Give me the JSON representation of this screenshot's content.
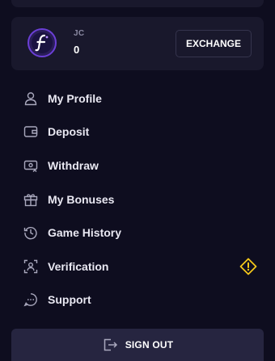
{
  "wallet": {
    "currency_code": "JC",
    "balance": "0",
    "exchange_label": "EXCHANGE"
  },
  "menu": {
    "items": [
      {
        "label": "My Profile",
        "icon": "user-icon"
      },
      {
        "label": "Deposit",
        "icon": "wallet-icon"
      },
      {
        "label": "Withdraw",
        "icon": "withdraw-icon"
      },
      {
        "label": "My Bonuses",
        "icon": "gift-icon"
      },
      {
        "label": "Game History",
        "icon": "history-icon"
      },
      {
        "label": "Verification",
        "icon": "verification-icon",
        "status_icon": "warning-icon"
      },
      {
        "label": "Support",
        "icon": "chat-icon"
      }
    ]
  },
  "sign_out": {
    "label": "SIGN OUT",
    "icon": "sign-out-icon"
  },
  "colors": {
    "background": "#0e0d1f",
    "card": "#19182c",
    "button": "#262540",
    "warning": "#f5c71a",
    "logo_accent": "#6b3fd6"
  }
}
